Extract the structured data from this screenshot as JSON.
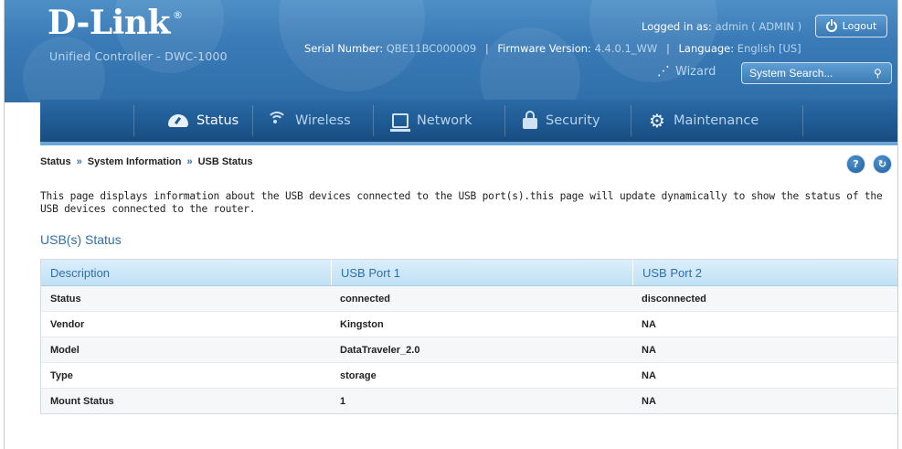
{
  "header": {
    "logo": "D-Link",
    "logo_mark": "®",
    "subtitle": "Unified Controller - DWC-1000",
    "serial_label": "Serial Number:",
    "serial_value": "QBE11BC000009",
    "firmware_label": "Firmware Version:",
    "firmware_value": "4.4.0.1_WW",
    "language_label": "Language:",
    "language_value": "English [US]",
    "logged_label": "Logged in as:",
    "logged_value": "admin ( ADMIN )",
    "logout_label": "Logout",
    "wizard_label": "Wizard",
    "search_placeholder": "System Search..."
  },
  "nav": {
    "items": [
      {
        "label": "Status",
        "icon": "dashboard-icon",
        "active": true
      },
      {
        "label": "Wireless",
        "icon": "wifi-icon",
        "active": false
      },
      {
        "label": "Network",
        "icon": "network-icon",
        "active": false
      },
      {
        "label": "Security",
        "icon": "lock-icon",
        "active": false
      },
      {
        "label": "Maintenance",
        "icon": "gears-icon",
        "active": false
      }
    ]
  },
  "breadcrumb": {
    "items": [
      "Status",
      "System Information",
      "USB Status"
    ],
    "separator": "»"
  },
  "help": {
    "help_label": "?",
    "refresh_label": "↻"
  },
  "page": {
    "description": "This page displays information about the USB devices connected to the USB port(s).this page will update dynamically to show the status of the USB devices connected to the router.",
    "section_title": "USB(s) Status"
  },
  "table": {
    "headers": [
      "Description",
      "USB Port 1",
      "USB Port 2"
    ],
    "rows": [
      [
        "Status",
        "connected",
        "disconnected"
      ],
      [
        "Vendor",
        "Kingston",
        "NA"
      ],
      [
        "Model",
        "DataTraveler_2.0",
        "NA"
      ],
      [
        "Type",
        "storage",
        "NA"
      ],
      [
        "Mount Status",
        "1",
        "NA"
      ]
    ]
  },
  "colors": {
    "header_bg": "#3a7bb7",
    "nav_bg": "#1f5a93",
    "accent": "#2f6ea9",
    "table_header_bg": "#cfe7f8"
  }
}
